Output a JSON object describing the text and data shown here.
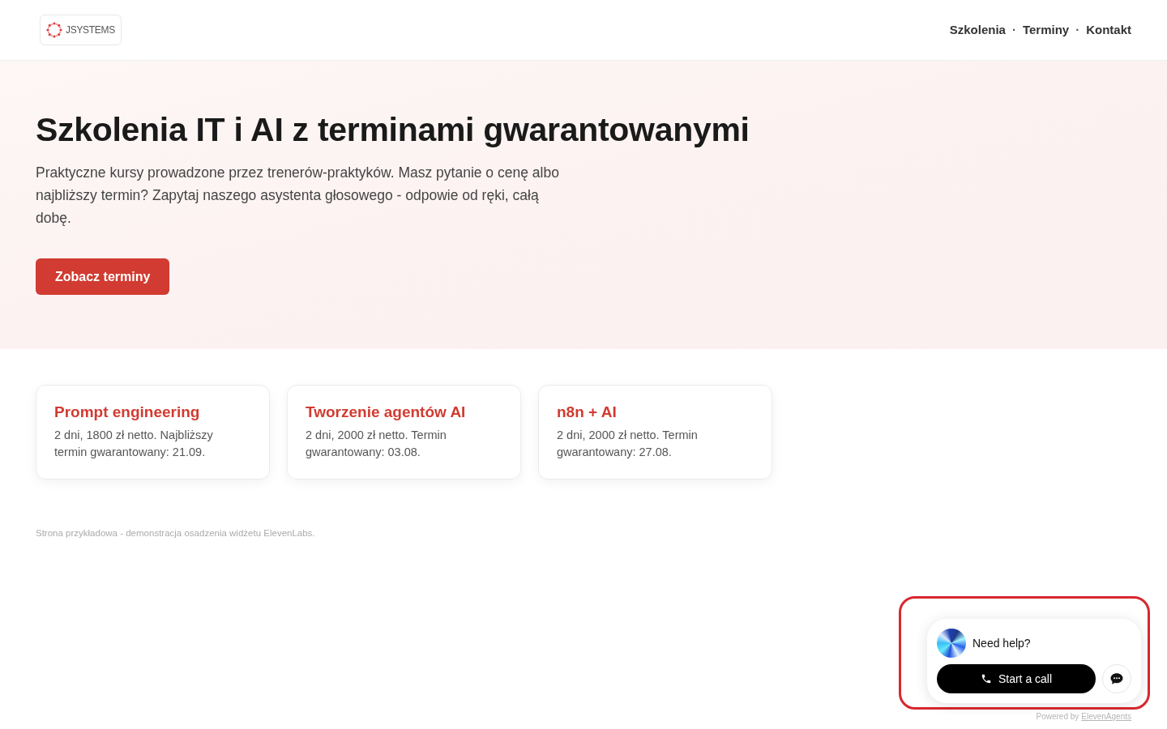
{
  "header": {
    "logo": {
      "text": "JSYSTEMS"
    },
    "nav": [
      {
        "label": "Szkolenia"
      },
      {
        "label": "Terminy"
      },
      {
        "label": "Kontakt"
      }
    ],
    "separators": [
      "·",
      "·"
    ]
  },
  "hero": {
    "title": "Szkolenia IT i AI z terminami gwarantowanymi",
    "text": "Praktyczne kursy prowadzone przez trenerów-praktyków. Masz pytanie o cenę albo najbliższy termin? Zapytaj naszego asystenta głosowego - odpowie od ręki, całą dobę.",
    "button": "Zobacz terminy"
  },
  "courses": [
    {
      "title": "Prompt engineering",
      "text": "2 dni, 1800 zł netto. Najbliższy termin gwarantowany: 21.09."
    },
    {
      "title": "Tworzenie agentów AI",
      "text": "2 dni, 2000 zł netto. Termin gwarantowany: 03.08."
    },
    {
      "title": "n8n + AI",
      "text": "2 dni, 2000 zł netto. Termin gwarantowany: 27.08."
    }
  ],
  "note": "Strona przykładowa - demonstracja osadzenia widżetu ElevenLabs.",
  "widget": {
    "prompt": "Need help?",
    "call_button": "Start a call",
    "powered_by": "Powered by",
    "powered_link": "ElevenAgents"
  }
}
